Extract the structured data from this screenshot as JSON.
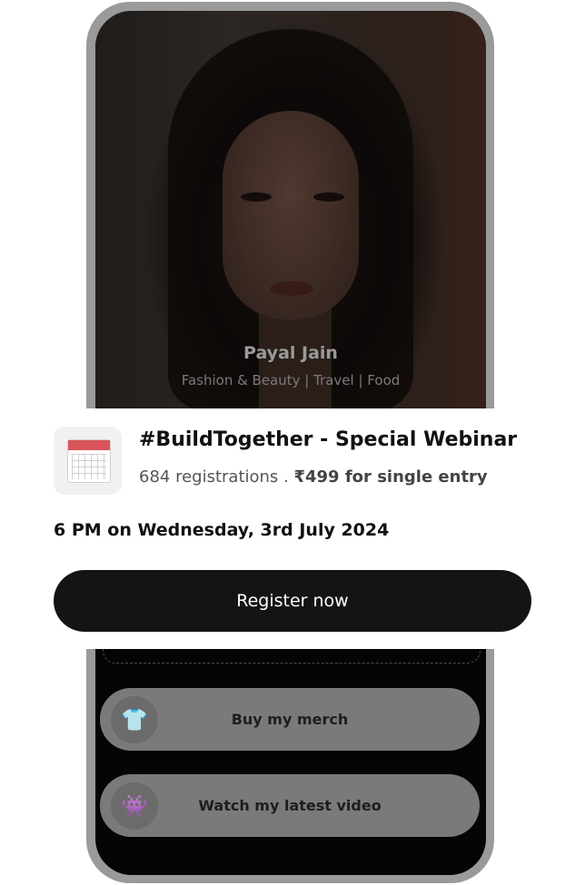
{
  "profile": {
    "name": "Payal Jain",
    "tags": "Fashion & Beauty | Travel | Food"
  },
  "links": [
    {
      "label": "Buy my merch",
      "icon": "tshirt-icon",
      "glyph": "👕"
    },
    {
      "label": "Watch my latest video",
      "icon": "alien-monster-icon",
      "glyph": "👾"
    }
  ],
  "event": {
    "icon": "calendar-icon",
    "title": "#BuildTogether - Special Webinar",
    "registrations": "684 registrations",
    "separator": " . ",
    "price": "₹499 for single entry",
    "datetime": "6 PM on Wednesday, 3rd July 2024"
  },
  "cta": {
    "register_label": "Register now"
  },
  "colors": {
    "cta_background": "#141414",
    "cta_text": "#ffffff",
    "frame": "#9a9a9a"
  }
}
